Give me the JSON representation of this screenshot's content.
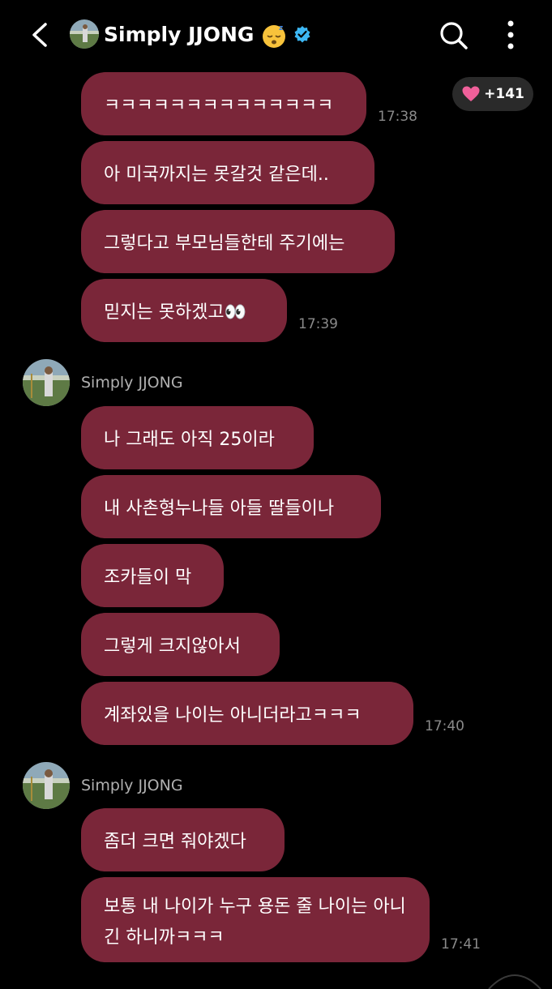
{
  "header": {
    "title": "Simply JJONG",
    "emoji": "sleeping-face",
    "verified": true,
    "accent_color": "#3db8f5"
  },
  "reaction": {
    "emoji": "heart",
    "count": "+141"
  },
  "groups": [
    {
      "sender": "",
      "messages": [
        {
          "text": "ㅋㅋㅋㅋㅋㅋㅋㅋㅋㅋㅋㅋㅋㅋ",
          "time": "17:38"
        },
        {
          "text": "아 미국까지는 못갈것 같은데..",
          "time": ""
        },
        {
          "text": "그렇다고 부모님들한테 주기에는",
          "time": ""
        },
        {
          "text": "믿지는 못하겠고👀",
          "time": "17:39"
        }
      ]
    },
    {
      "sender": "Simply JJONG",
      "messages": [
        {
          "text": "나 그래도 아직 25이라",
          "time": ""
        },
        {
          "text": "내 사촌형누나들 아들 딸들이나",
          "time": ""
        },
        {
          "text": "조카들이 막",
          "time": ""
        },
        {
          "text": "그렇게 크지않아서",
          "time": ""
        },
        {
          "text": "계좌있을 나이는 아니더라고ㅋㅋㅋ",
          "time": "17:40"
        }
      ]
    },
    {
      "sender": "Simply JJONG",
      "messages": [
        {
          "text": "좀더 크면 줘야겠다",
          "time": ""
        },
        {
          "text": "보통 내 나이가 누구 용돈 줄 나이는 아니긴 하니까ㅋㅋㅋ",
          "time": "17:41"
        }
      ]
    }
  ],
  "colors": {
    "background": "#000000",
    "bubble": "#7a2639",
    "timestamp": "#8a8a8a",
    "sender_name": "#b0b0b0"
  }
}
